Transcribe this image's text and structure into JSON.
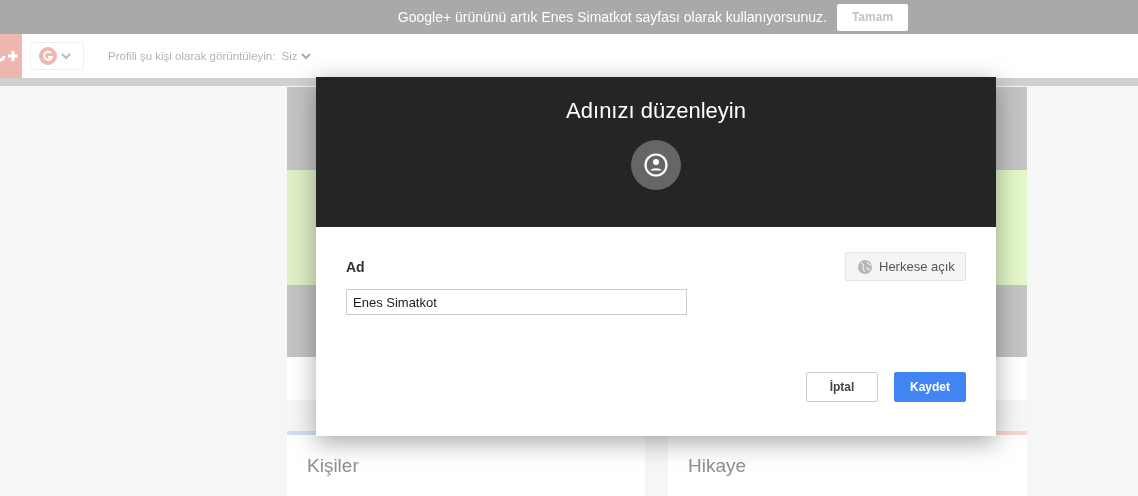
{
  "banner": {
    "message": "Google+ ürününü artık Enes Simatkot sayfası olarak kullanıyorsunuz.",
    "button": "Tamam"
  },
  "header": {
    "view_as_label": "Profili şu kişi olarak görüntüleyin:",
    "view_as_value": "Siz"
  },
  "cards": [
    {
      "title": "Kişiler",
      "color": "#d3def5"
    },
    {
      "title": "Hikaye",
      "color": "#f7d6d0"
    }
  ],
  "dialog": {
    "title": "Adınızı düzenleyin",
    "field_label": "Ad",
    "field_value": "Enes Simatkot",
    "visibility": "Herkese açık",
    "buttons": [
      {
        "label": "İptal",
        "kind": "secondary"
      },
      {
        "label": "Kaydet",
        "kind": "primary"
      }
    ]
  }
}
